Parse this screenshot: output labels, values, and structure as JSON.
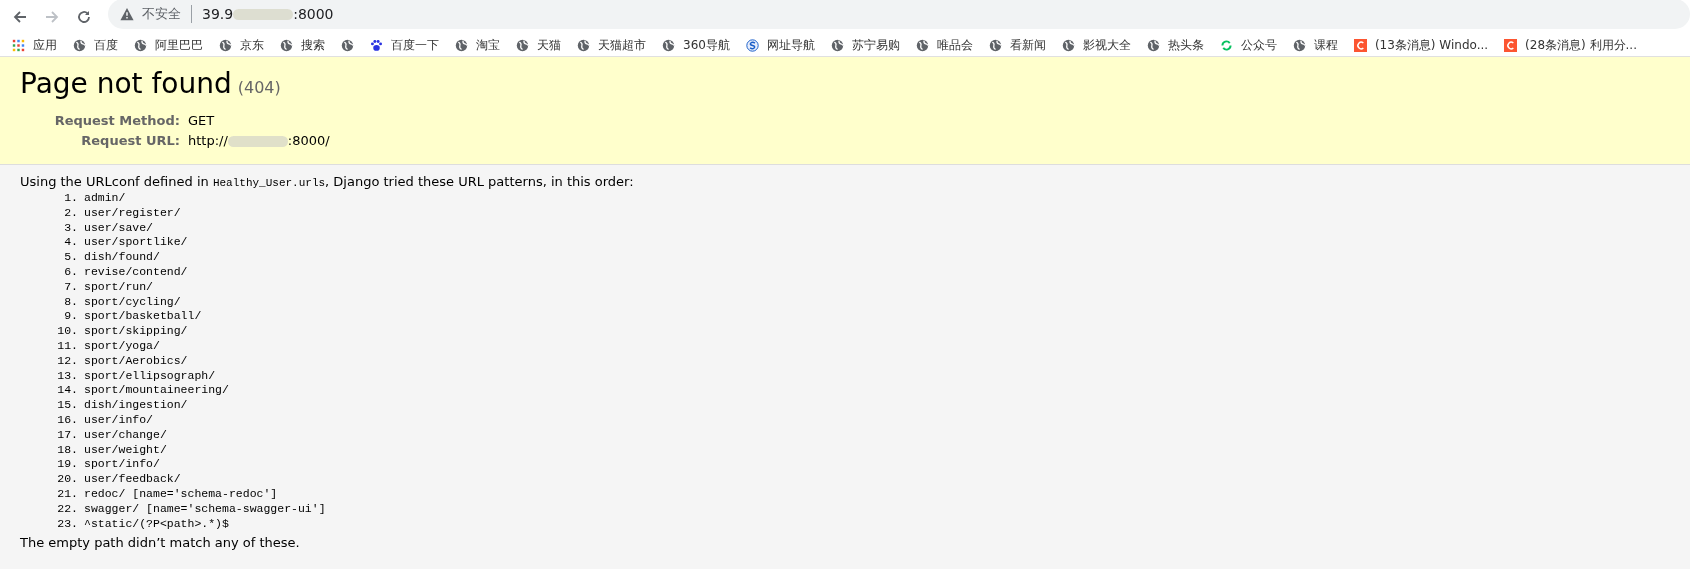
{
  "browser": {
    "security_label": "不安全",
    "url_start": "39.9",
    "url_end": ":8000"
  },
  "bookmarks": [
    {
      "kind": "apps",
      "label": "应用"
    },
    {
      "kind": "globe",
      "label": "百度"
    },
    {
      "kind": "globe",
      "label": "阿里巴巴"
    },
    {
      "kind": "globe",
      "label": "京东"
    },
    {
      "kind": "globe",
      "label": "搜索"
    },
    {
      "kind": "globe"
    },
    {
      "kind": "paw",
      "label": "百度一下"
    },
    {
      "kind": "globe",
      "label": "淘宝"
    },
    {
      "kind": "globe",
      "label": "天猫"
    },
    {
      "kind": "globe",
      "label": "天猫超市"
    },
    {
      "kind": "globe",
      "label": "360导航"
    },
    {
      "kind": "s-circle",
      "label": "网址导航"
    },
    {
      "kind": "globe",
      "label": "苏宁易购"
    },
    {
      "kind": "globe",
      "label": "唯品会"
    },
    {
      "kind": "globe",
      "label": "看新闻"
    },
    {
      "kind": "globe",
      "label": "影视大全"
    },
    {
      "kind": "globe",
      "label": "热头条"
    },
    {
      "kind": "ring",
      "label": "公众号"
    },
    {
      "kind": "globe",
      "label": "课程"
    },
    {
      "kind": "c-square",
      "label": "(13条消息) Windo..."
    },
    {
      "kind": "c-square",
      "label": "(28条消息) 利用分..."
    }
  ],
  "header": {
    "title": "Page not found",
    "code": "(404)",
    "details": [
      {
        "label": "Request Method:",
        "value_start": "GET"
      },
      {
        "label": "Request URL:",
        "value_start": "http://",
        "value_end": ":8000/"
      }
    ]
  },
  "info": {
    "intro_before": "Using the URLconf defined in ",
    "module": "Healthy_User.urls",
    "intro_after": ", Django tried these URL patterns, in this order:",
    "patterns": [
      {
        "number": "1.",
        "pattern": "admin/"
      },
      {
        "number": "2.",
        "pattern": "user/register/"
      },
      {
        "number": "3.",
        "pattern": "user/save/"
      },
      {
        "number": "4.",
        "pattern": "user/sportlike/"
      },
      {
        "number": "5.",
        "pattern": "dish/found/"
      },
      {
        "number": "6.",
        "pattern": "revise/contend/"
      },
      {
        "number": "7.",
        "pattern": "sport/run/"
      },
      {
        "number": "8.",
        "pattern": "sport/cycling/"
      },
      {
        "number": "9.",
        "pattern": "sport/basketball/"
      },
      {
        "number": "10.",
        "pattern": "sport/skipping/"
      },
      {
        "number": "11.",
        "pattern": "sport/yoga/"
      },
      {
        "number": "12.",
        "pattern": "sport/Aerobics/"
      },
      {
        "number": "13.",
        "pattern": "sport/ellipsograph/"
      },
      {
        "number": "14.",
        "pattern": "sport/mountaineering/"
      },
      {
        "number": "15.",
        "pattern": "dish/ingestion/"
      },
      {
        "number": "16.",
        "pattern": "user/info/"
      },
      {
        "number": "17.",
        "pattern": "user/change/"
      },
      {
        "number": "18.",
        "pattern": "user/weight/"
      },
      {
        "number": "19.",
        "pattern": "sport/info/"
      },
      {
        "number": "20.",
        "pattern": "user/feedback/"
      },
      {
        "number": "21.",
        "pattern": "redoc/ [name='schema-redoc']"
      },
      {
        "number": "22.",
        "pattern": "swagger/ [name='schema-swagger-ui']"
      },
      {
        "number": "23.",
        "pattern": "^static/(?P<path>.*)$"
      }
    ],
    "footer": "The empty path didn’t match any of these."
  }
}
